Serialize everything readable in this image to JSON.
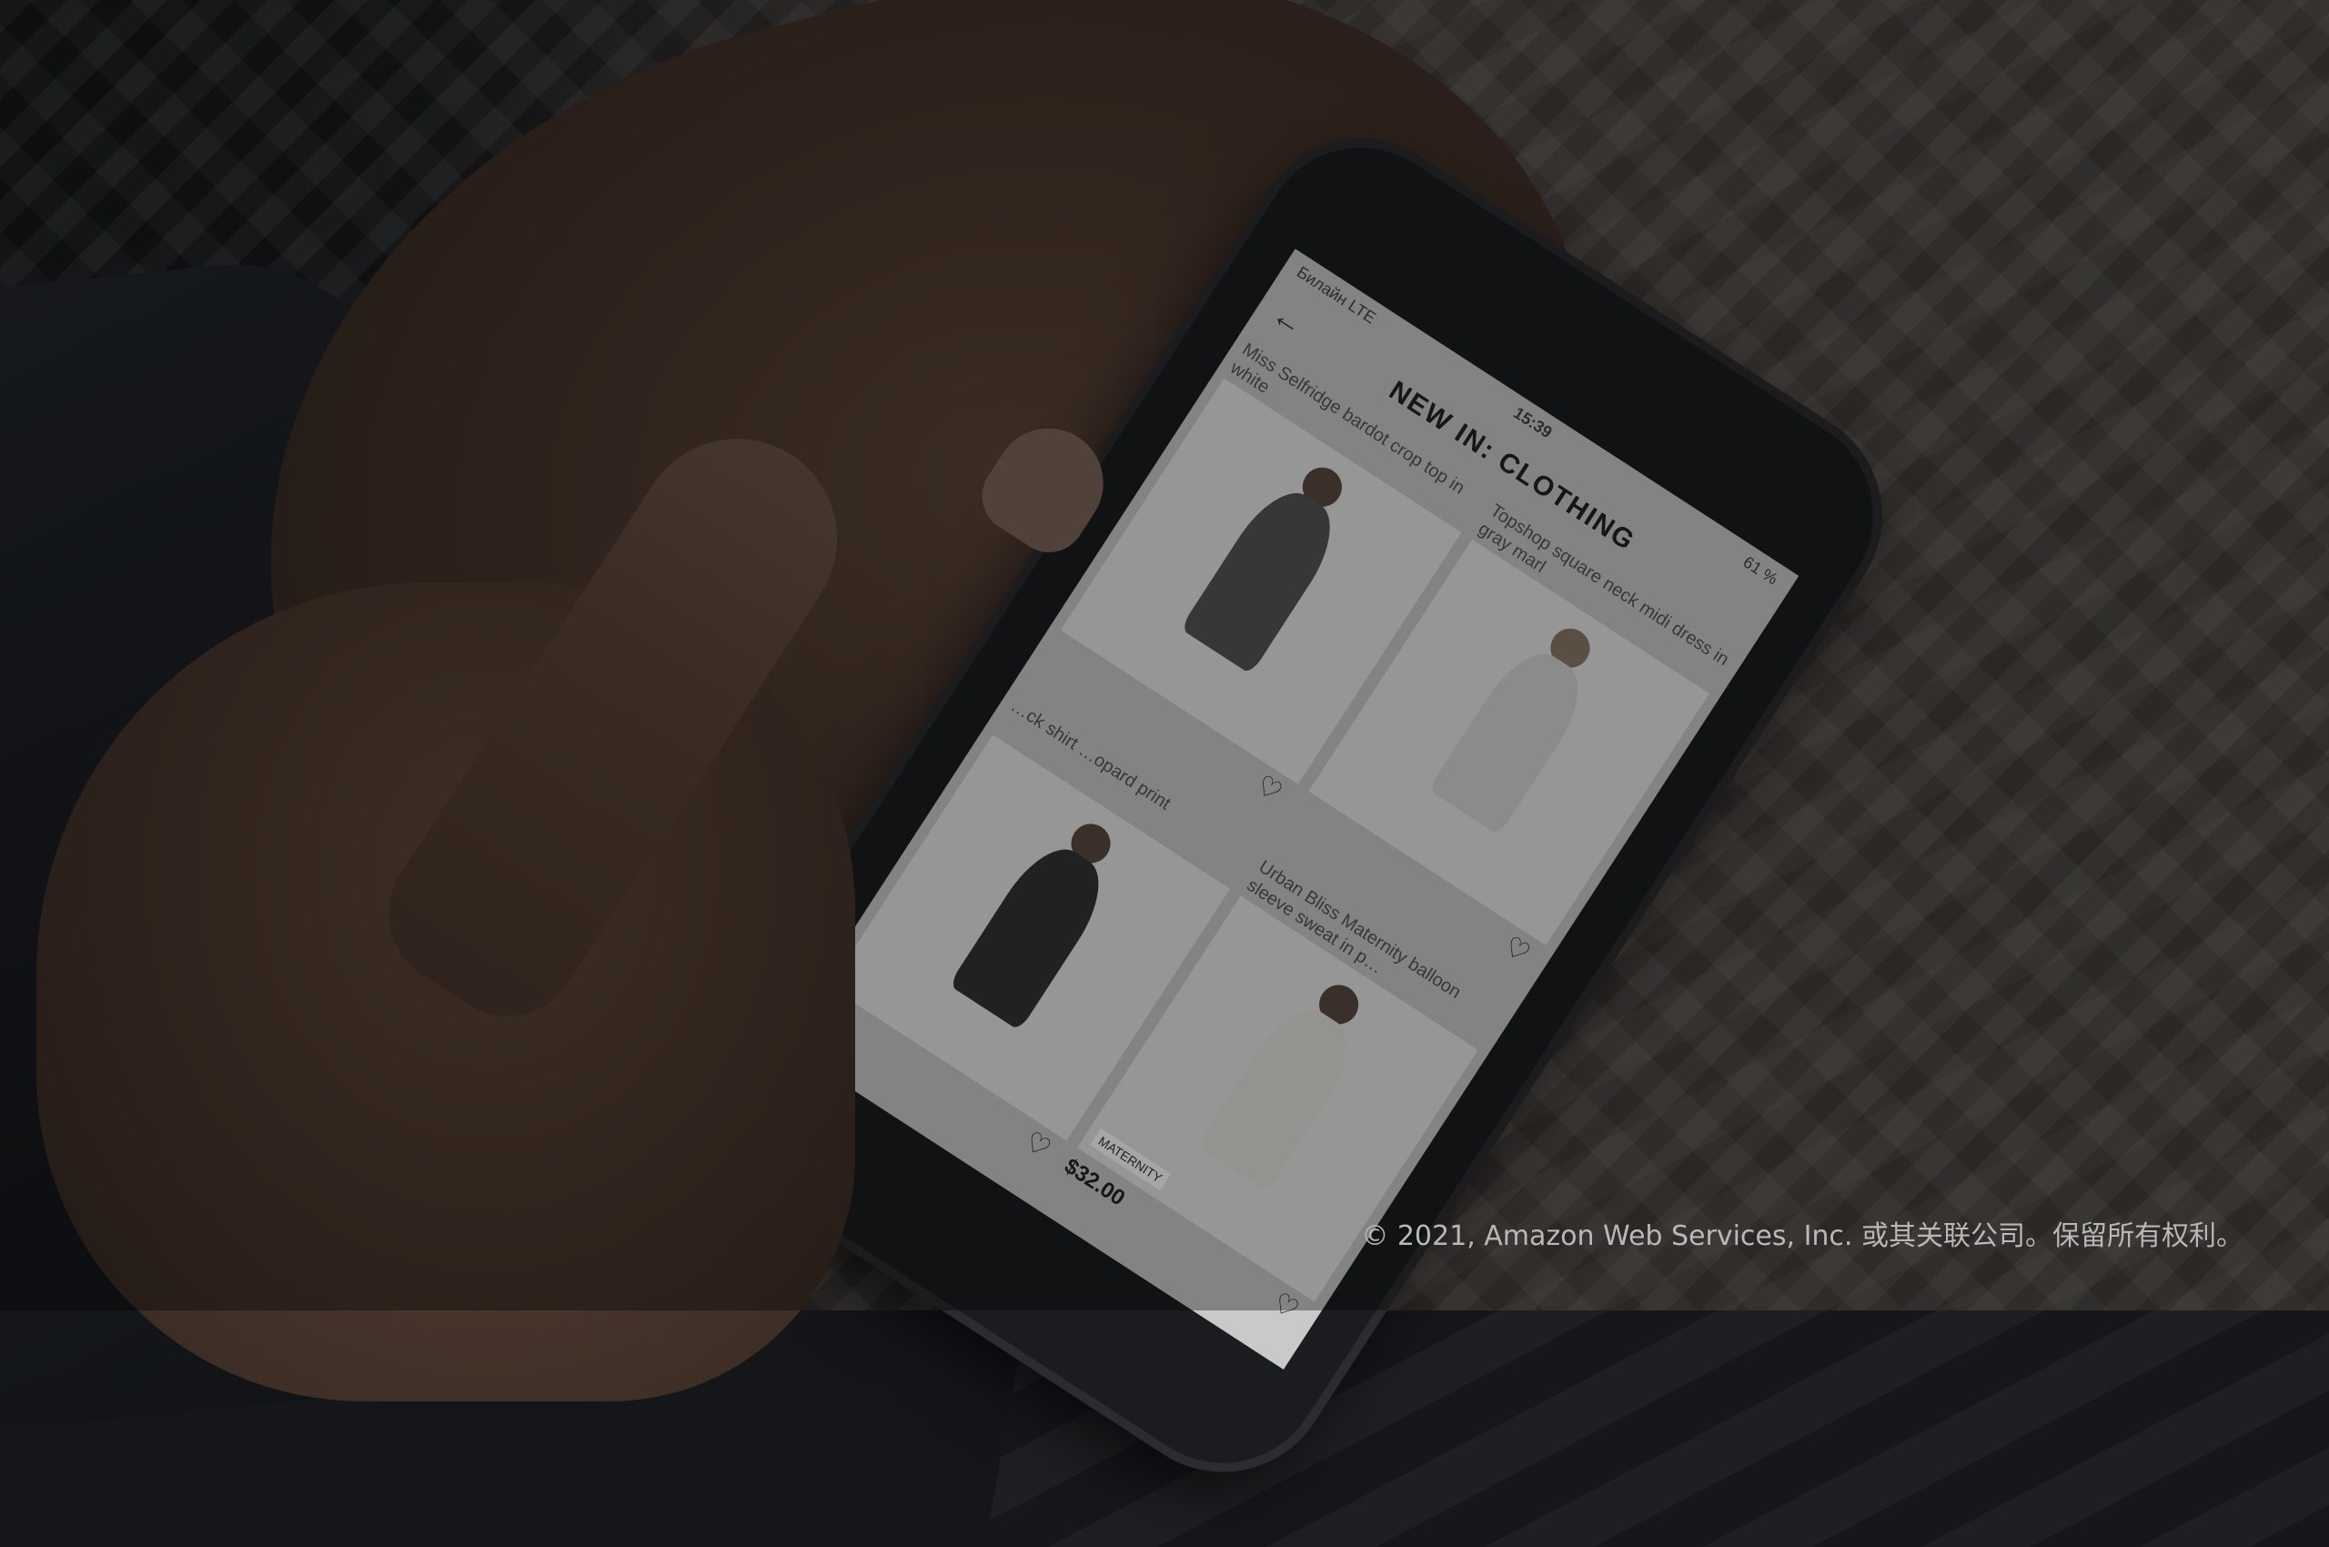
{
  "status_bar": {
    "carrier": "Билайн LTE",
    "time": "15:39",
    "battery": "61 %"
  },
  "header": {
    "back_icon": "arrow-left-icon",
    "title": "NEW IN: CLOTHING"
  },
  "products": [
    {
      "name": "Miss Selfridge bardot crop top in white",
      "price": "",
      "badge": ""
    },
    {
      "name": "Topshop square neck midi dress in gray marl",
      "price": "",
      "badge": ""
    },
    {
      "name": "…ck shirt …opard print",
      "price": "",
      "badge": ""
    },
    {
      "name": "Urban Bliss Maternity balloon sleeve sweat in p…",
      "price": "$32.00",
      "badge": "MATERNITY"
    }
  ],
  "heart_icon": "heart-outline-icon",
  "copyright": "© 2021, Amazon Web Services, Inc. 或其关联公司。保留所有权利。"
}
